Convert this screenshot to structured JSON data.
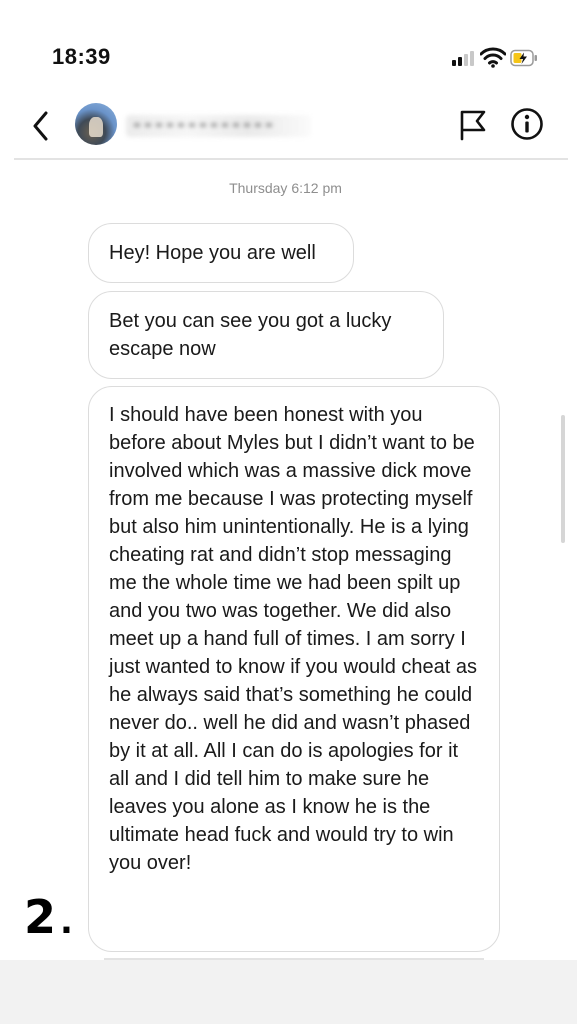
{
  "status_bar": {
    "time": "18:39",
    "icons": [
      "cellular-signal-icon",
      "wifi-icon",
      "battery-charging-icon"
    ],
    "battery_color": "#f5c518"
  },
  "header": {
    "back_icon": "chevron-left-icon",
    "avatar": "profile-avatar",
    "username": "",
    "flag_icon": "flag-icon",
    "info_icon": "info-icon"
  },
  "thread": {
    "timestamp": "Thursday 6:12 pm",
    "messages": [
      {
        "text": "Hey! Hope you are well"
      },
      {
        "text": "Bet you can see you got a lucky escape now"
      },
      {
        "text": "I should have been honest with you before about Myles but I didn’t want to be involved which was a massive dick move from me because I was protecting myself but also him unintentionally. He is a lying cheating rat and didn’t stop messaging me the whole time we had been spilt up and you two was together. We did also meet up a hand full of times. I am sorry I just wanted to know if you would cheat as he always said that’s something he could never do.. well he did and wasn’t phased by it at all. All I can do is apologies for it all and I did tell him to make sure he leaves you alone as I know he is the ultimate head fuck and would try to win you over!"
      }
    ]
  },
  "overlay": {
    "page_number": "2",
    "page_dot": "."
  }
}
